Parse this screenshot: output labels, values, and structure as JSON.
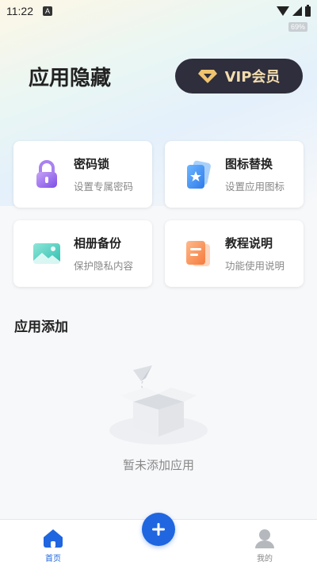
{
  "status_bar": {
    "time": "11:22",
    "notification_icon": "a-icon",
    "battery_tag": "69%"
  },
  "header": {
    "title": "应用隐藏",
    "vip_label": "VIP会员"
  },
  "cards": [
    {
      "title": "密码锁",
      "subtitle": "设置专属密码",
      "icon": "lock-icon"
    },
    {
      "title": "图标替换",
      "subtitle": "设置应用图标",
      "icon": "star-card-icon"
    },
    {
      "title": "相册备份",
      "subtitle": "保护隐私内容",
      "icon": "photo-icon"
    },
    {
      "title": "教程说明",
      "subtitle": "功能使用说明",
      "icon": "document-icon"
    }
  ],
  "section": {
    "title": "应用添加",
    "empty_text": "暂未添加应用"
  },
  "tabbar": {
    "home_label": "首页",
    "mine_label": "我的"
  },
  "colors": {
    "accent": "#1f66e0",
    "vip_bg": "#2e2e3c",
    "vip_text": "#f3dcae"
  }
}
